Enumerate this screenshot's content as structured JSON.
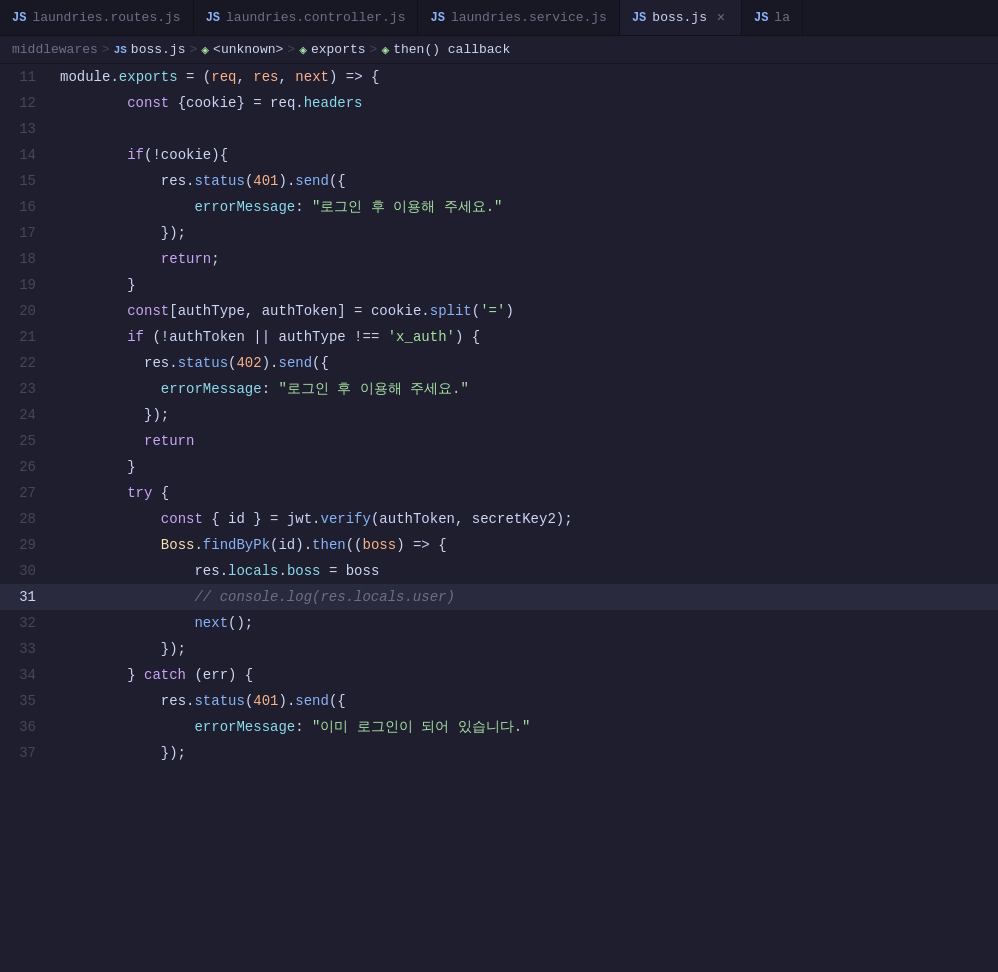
{
  "tabs": [
    {
      "id": "laundries-routes",
      "icon": "JS",
      "label": "laundries.routes.js",
      "active": false,
      "closable": false
    },
    {
      "id": "laundries-controller",
      "icon": "JS",
      "label": "laundries.controller.js",
      "active": false,
      "closable": false
    },
    {
      "id": "laundries-service",
      "icon": "JS",
      "label": "laundries.service.js",
      "active": false,
      "closable": false
    },
    {
      "id": "boss",
      "icon": "JS",
      "label": "boss.js",
      "active": true,
      "closable": true
    },
    {
      "id": "la-partial",
      "icon": "JS",
      "label": "la",
      "active": false,
      "closable": false
    }
  ],
  "breadcrumb": [
    {
      "type": "text",
      "value": "middlewares"
    },
    {
      "type": "sep",
      "value": ">"
    },
    {
      "type": "icon-js",
      "value": "JS"
    },
    {
      "type": "text",
      "value": "boss.js"
    },
    {
      "type": "sep",
      "value": ">"
    },
    {
      "type": "icon-cube",
      "value": "⬡"
    },
    {
      "type": "text",
      "value": "<unknown>"
    },
    {
      "type": "sep",
      "value": ">"
    },
    {
      "type": "icon-cube",
      "value": "⬡"
    },
    {
      "type": "text",
      "value": "exports"
    },
    {
      "type": "sep",
      "value": ">"
    },
    {
      "type": "icon-cube",
      "value": "⬡"
    },
    {
      "type": "text",
      "value": "then() callback"
    }
  ],
  "lines": [
    {
      "num": 11,
      "active": false
    },
    {
      "num": 12,
      "active": false
    },
    {
      "num": 13,
      "active": false
    },
    {
      "num": 14,
      "active": false
    },
    {
      "num": 15,
      "active": false
    },
    {
      "num": 16,
      "active": false
    },
    {
      "num": 17,
      "active": false
    },
    {
      "num": 18,
      "active": false
    },
    {
      "num": 19,
      "active": false
    },
    {
      "num": 20,
      "active": false
    },
    {
      "num": 21,
      "active": false
    },
    {
      "num": 22,
      "active": false
    },
    {
      "num": 23,
      "active": false
    },
    {
      "num": 24,
      "active": false
    },
    {
      "num": 25,
      "active": false
    },
    {
      "num": 26,
      "active": false
    },
    {
      "num": 27,
      "active": false
    },
    {
      "num": 28,
      "active": false
    },
    {
      "num": 29,
      "active": false
    },
    {
      "num": 30,
      "active": false
    },
    {
      "num": 31,
      "active": true
    },
    {
      "num": 32,
      "active": false
    },
    {
      "num": 33,
      "active": false
    },
    {
      "num": 34,
      "active": false
    },
    {
      "num": 35,
      "active": false
    },
    {
      "num": 36,
      "active": false
    },
    {
      "num": 37,
      "active": false
    }
  ]
}
